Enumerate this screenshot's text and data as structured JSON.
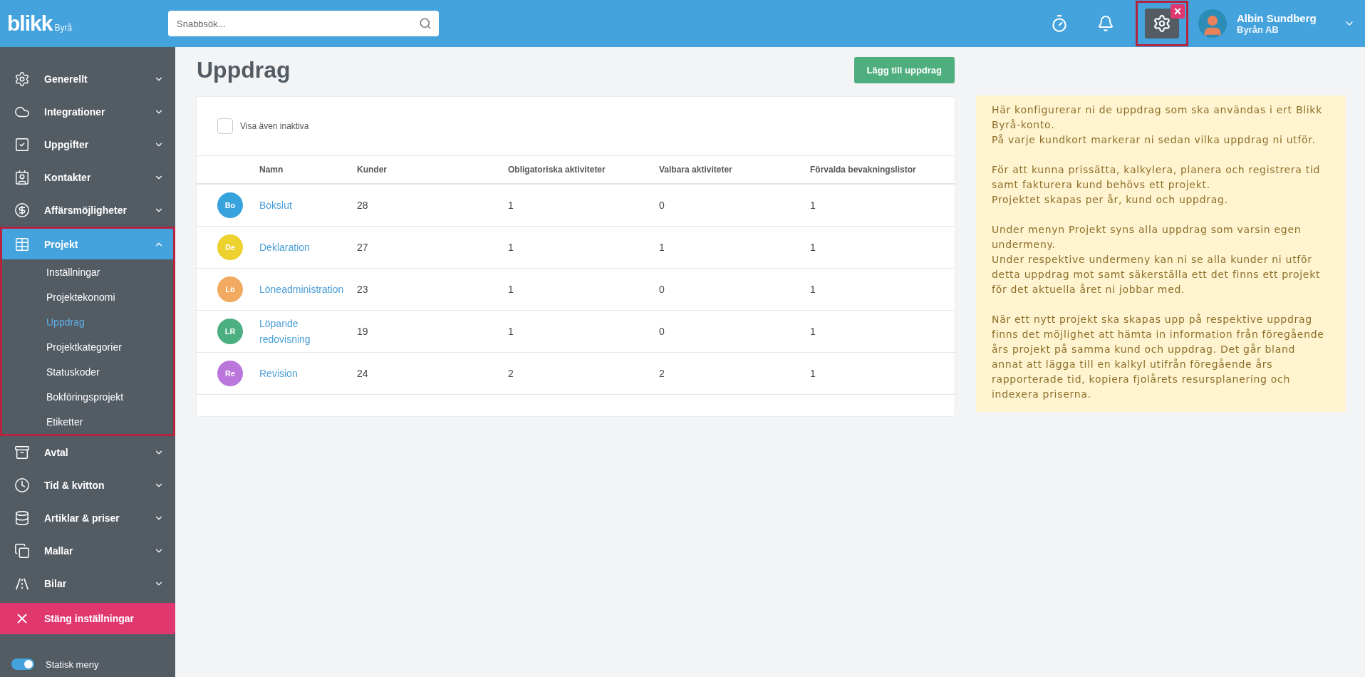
{
  "topbar": {
    "logo": "blikk",
    "logo_suffix": "Byrå",
    "search": {
      "placeholder": "Snabbsök..."
    },
    "settings_active": true,
    "settings_badge": "×",
    "user": {
      "name": "Albin Sundberg",
      "company": "Byrån AB"
    }
  },
  "sidebar": {
    "items": [
      {
        "label": "Generellt",
        "expanded": false,
        "selected": false
      },
      {
        "label": "Integrationer",
        "expanded": false,
        "selected": false
      },
      {
        "label": "Uppgifter",
        "expanded": false,
        "selected": false
      },
      {
        "label": "Kontakter",
        "expanded": false,
        "selected": false
      },
      {
        "label": "Affärsmöjligheter",
        "expanded": false,
        "selected": false
      },
      {
        "label": "Projekt",
        "expanded": true,
        "selected": true,
        "highlighted": true,
        "children": [
          {
            "label": "Inställningar",
            "selected": false
          },
          {
            "label": "Projektekonomi",
            "selected": false
          },
          {
            "label": "Uppdrag",
            "selected": true
          },
          {
            "label": "Projektkategorier",
            "selected": false
          },
          {
            "label": "Statuskoder",
            "selected": false
          },
          {
            "label": "Bokföringsprojekt",
            "selected": false
          },
          {
            "label": "Etiketter",
            "selected": false
          }
        ]
      },
      {
        "label": "Avtal",
        "expanded": false,
        "selected": false
      },
      {
        "label": "Tid & kvitton",
        "expanded": false,
        "selected": false
      },
      {
        "label": "Artiklar & priser",
        "expanded": false,
        "selected": false
      },
      {
        "label": "Mallar",
        "expanded": false,
        "selected": false
      },
      {
        "label": "Bilar",
        "expanded": false,
        "selected": false
      }
    ],
    "close_button": "Stäng inställningar",
    "static_menu": {
      "label": "Statisk meny",
      "on": true
    }
  },
  "page": {
    "title": "Uppdrag",
    "add_button": "Lägg till uppdrag",
    "show_inactive": {
      "label": "Visa även inaktiva",
      "checked": false
    },
    "table": {
      "columns": [
        "Namn",
        "Kunder",
        "Obligatoriska aktiviteter",
        "Valbara aktiviteter",
        "Förvalda bevakningslistor"
      ],
      "rows": [
        {
          "initials": "Bo",
          "color": "#36a3dd",
          "name": "Bokslut",
          "customers": "28",
          "mandatory": "1",
          "optional": "0",
          "watchlists": "1"
        },
        {
          "initials": "De",
          "color": "#ecd12f",
          "name": "Deklaration",
          "customers": "27",
          "mandatory": "1",
          "optional": "1",
          "watchlists": "1"
        },
        {
          "initials": "Lö",
          "color": "#f2a960",
          "name": "Löneadministration",
          "customers": "23",
          "mandatory": "1",
          "optional": "0",
          "watchlists": "1"
        },
        {
          "initials": "LR",
          "color": "#4caf82",
          "name": "Löpande redovisning",
          "customers": "19",
          "mandatory": "1",
          "optional": "0",
          "watchlists": "1"
        },
        {
          "initials": "Re",
          "color": "#bb76dc",
          "name": "Revision",
          "customers": "24",
          "mandatory": "2",
          "optional": "2",
          "watchlists": "1"
        }
      ]
    }
  },
  "info": {
    "paragraphs": [
      [
        "Här konfigurerar ni de uppdrag som ska användas i ert Blikk Byrå-konto.",
        "På varje kundkort markerar ni sedan vilka uppdrag ni utför."
      ],
      [
        "För att kunna prissätta, kalkylera, planera och registrera tid samt fakturera kund behövs ett projekt.",
        "Projektet skapas per år, kund och uppdrag."
      ],
      [
        "Under menyn Projekt syns alla uppdrag som varsin egen undermeny.",
        "Under respektive undermeny kan ni se alla kunder ni utför detta uppdrag mot samt säkerställa ett det finns ett projekt för det aktuella året ni jobbar med."
      ],
      [
        "När ett nytt projekt ska skapas upp på respektive uppdrag finns det möjlighet att hämta in information från föregående års projekt på samma kund och uppdrag. Det går bland annat att lägga till en kalkyl utifrån föregående års rapporterade tid, kopiera fjolårets resursplanering och indexera priserna."
      ]
    ]
  }
}
